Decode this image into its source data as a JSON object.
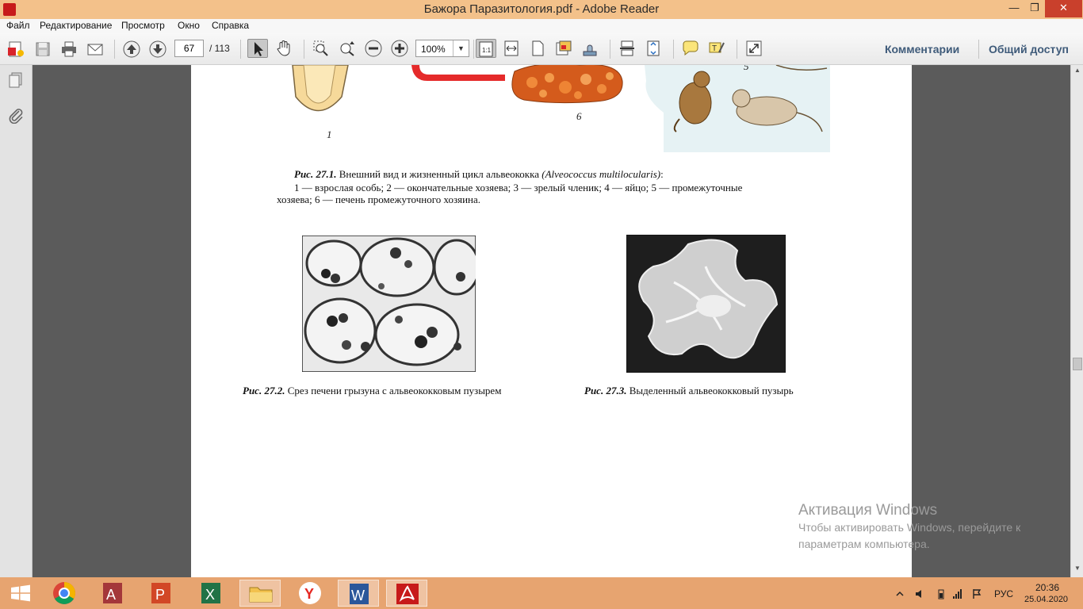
{
  "window": {
    "title": "Бажора Паразитология.pdf - Adobe Reader",
    "minimize": "—",
    "maximize": "❐",
    "close": "✕"
  },
  "menu": [
    "Файл",
    "Редактирование",
    "Просмотр",
    "Окно",
    "Справка"
  ],
  "toolbar": {
    "page_current": "67",
    "page_total": "/ 113",
    "zoom": "100%",
    "zoom_dropdown": "▼",
    "comments": "Комментарии",
    "share": "Общий доступ",
    "accent": "#3f5b7a"
  },
  "document": {
    "fig1_numbers": {
      "n1": "1",
      "n6": "6",
      "n5": "5"
    },
    "fig1_caption_label": "Рис. 27.1.",
    "fig1_caption_text": " Внешний вид и жизненный цикл альвеококка ",
    "fig1_caption_latin": "(Alveococcus multilocularis)",
    "fig1_caption_end": ":",
    "fig1_legend_1": "1 — взрослая особь; 2 — окончательные хозяева; 3 — зрелый членик; 4 — яйцо; 5 — промежуточные",
    "fig1_legend_2": "хозяева; 6 — печень промежуточного хозяина.",
    "fig2_label": "Рис. 27.2.",
    "fig2_text": " Срез печени грызуна с альвеококковым пузырем",
    "fig3_label": "Рис. 27.3.",
    "fig3_text": "  Выделенный альвеококковый пузырь"
  },
  "scrollbar": {
    "up": "▲",
    "down": "▼"
  },
  "watermark": {
    "title": "Активация Windows",
    "line1": "Чтобы активировать Windows, перейдите к",
    "line2": "параметрам компьютера."
  },
  "taskbar": {
    "apps": [
      "windows-start",
      "chrome",
      "access",
      "powerpoint",
      "excel",
      "file-explorer",
      "yandex-browser",
      "word",
      "adobe-reader"
    ],
    "language": "РУС",
    "time": "20:36",
    "date": "25.04.2020",
    "color": "#e7a470"
  }
}
